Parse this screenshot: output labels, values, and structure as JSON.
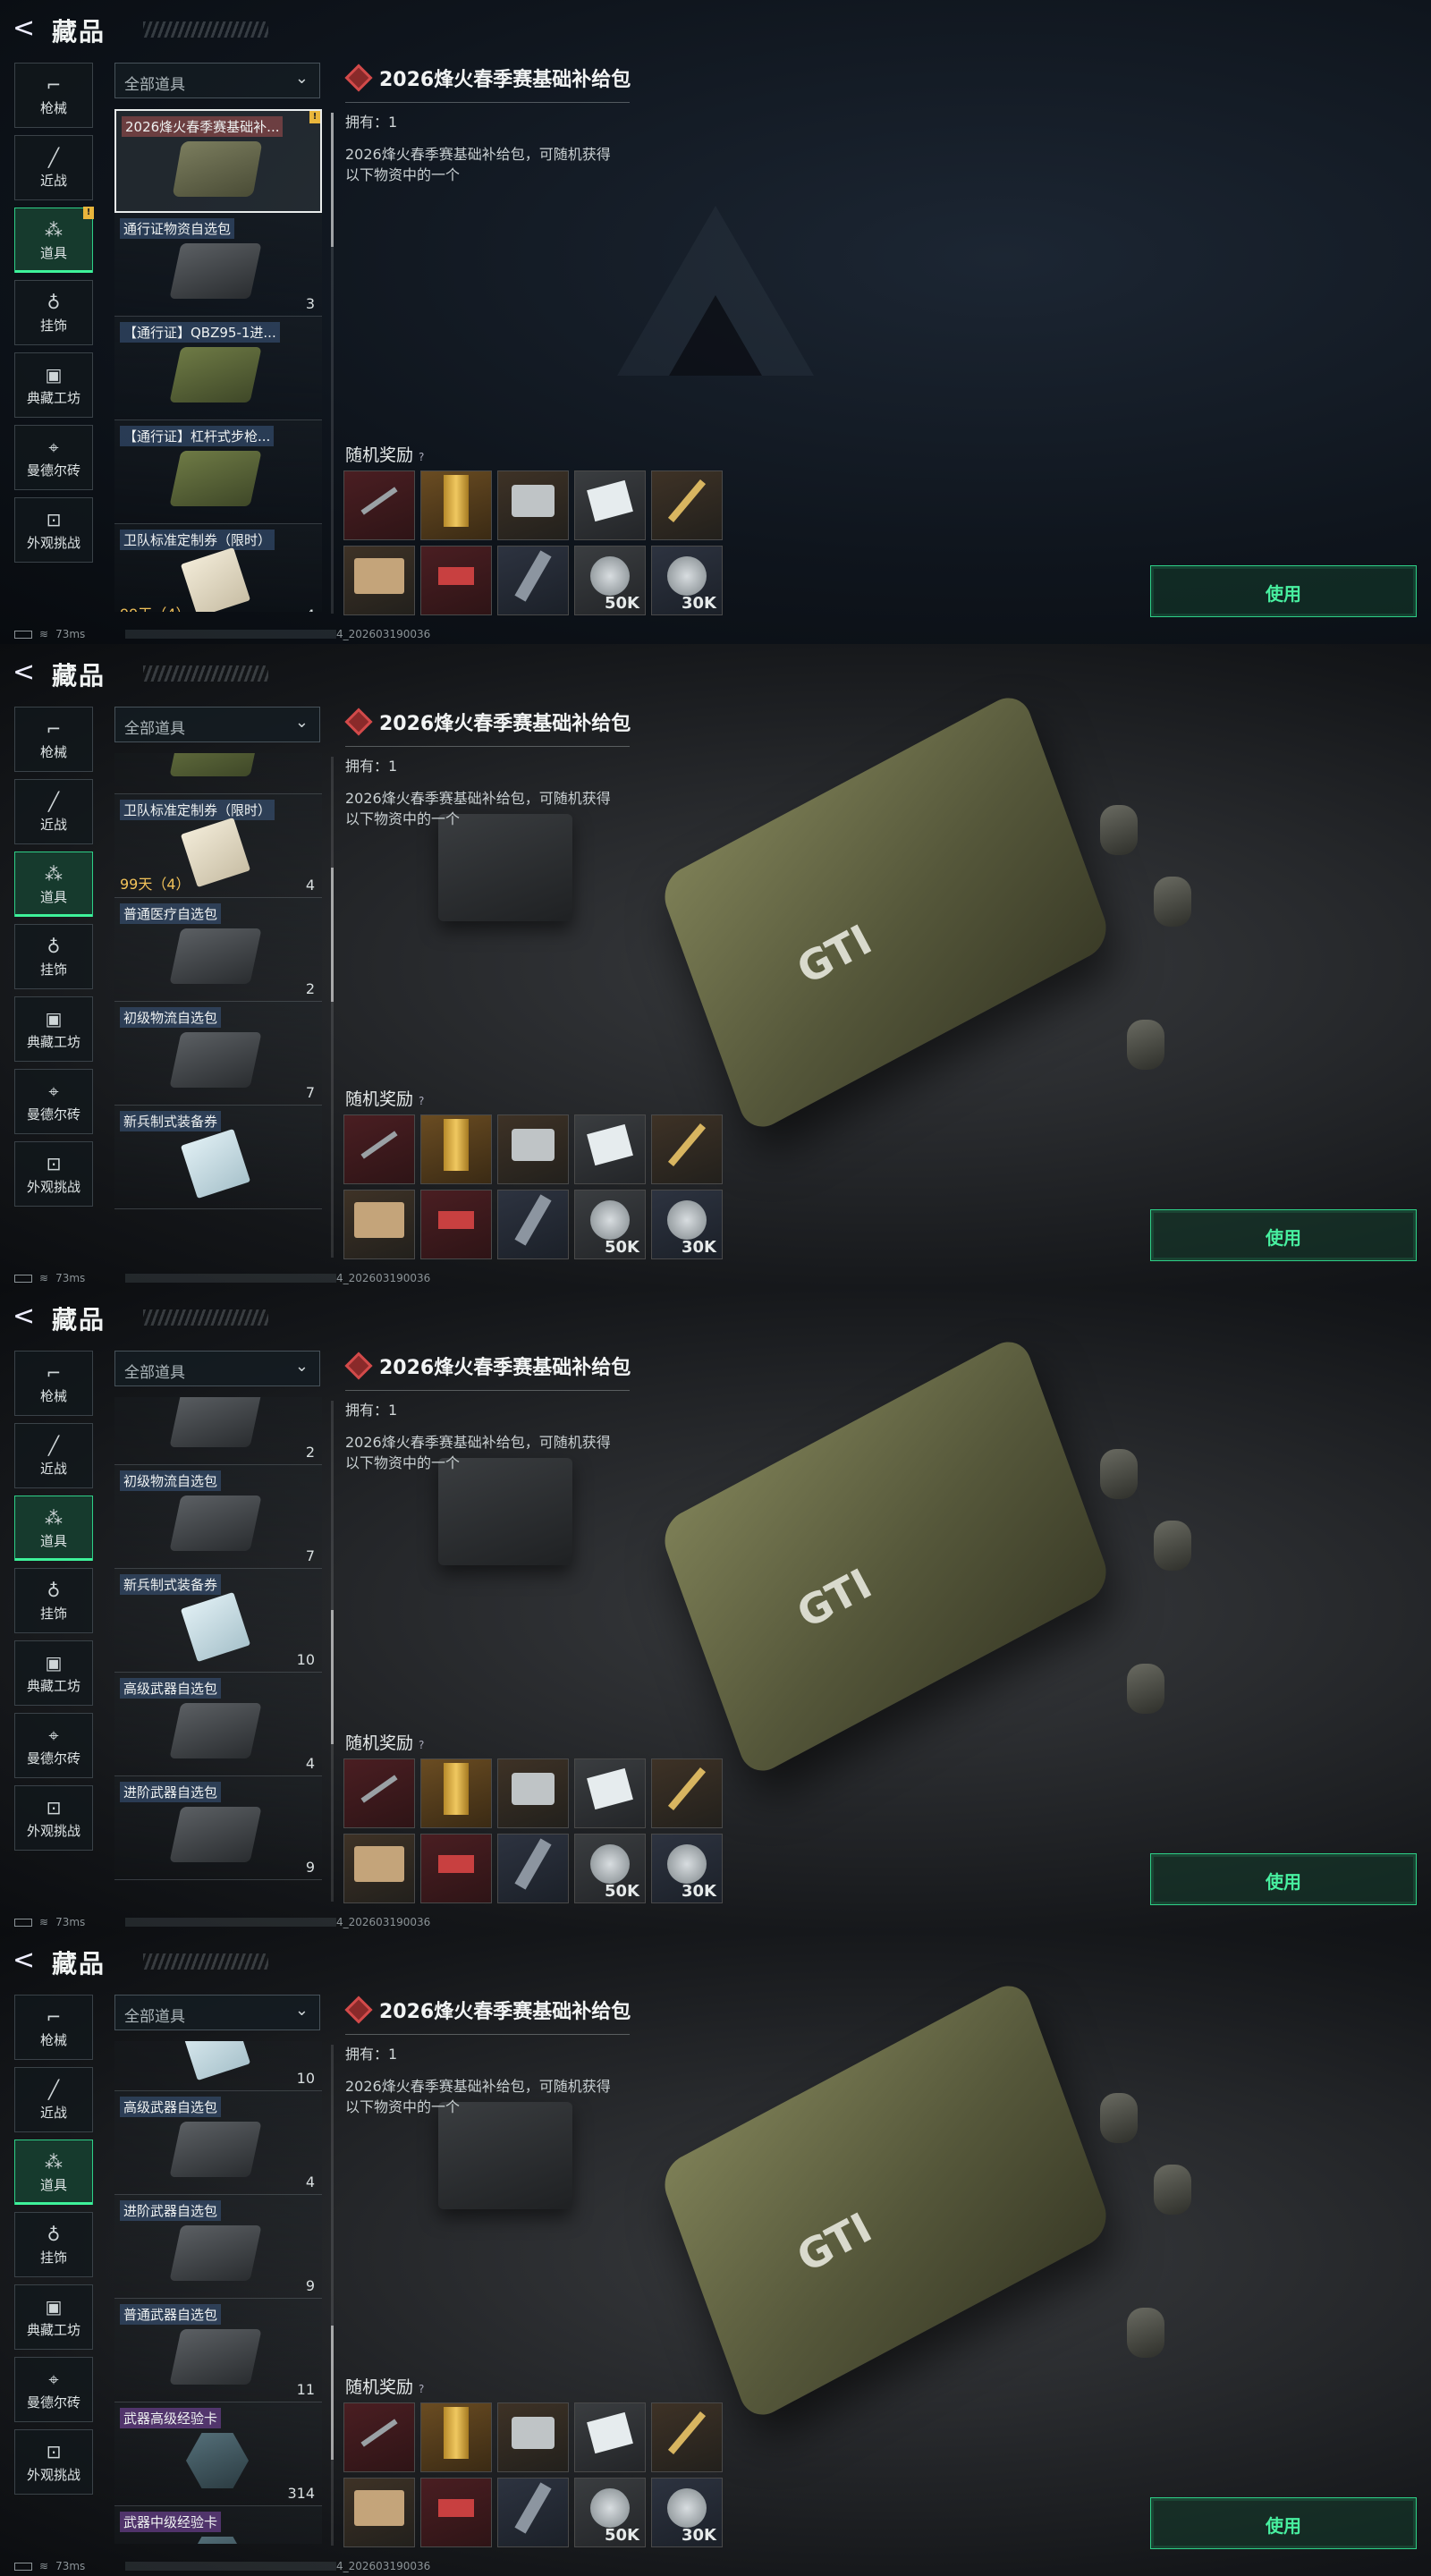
{
  "header": {
    "back": "<",
    "title": "藏品"
  },
  "categories": [
    {
      "label": "枪械",
      "icon": "gun-icon"
    },
    {
      "label": "近战",
      "icon": "knife-icon"
    },
    {
      "label": "道具",
      "icon": "items-icon"
    },
    {
      "label": "挂饰",
      "icon": "charm-icon"
    },
    {
      "label": "典藏工坊",
      "icon": "workshop-icon"
    },
    {
      "label": "曼德尔砖",
      "icon": "brick-icon"
    },
    {
      "label": "外观挑战",
      "icon": "challenge-icon"
    }
  ],
  "selected_category": "道具",
  "filter": {
    "label": "全部道具"
  },
  "detail": {
    "title": "2026烽火春季赛基础补给包",
    "owned": "拥有：1",
    "description": "2026烽火春季赛基础补给包，可随机获得以下物资中的一个",
    "reward_label": "随机奖励",
    "help": "?"
  },
  "rewards": [
    {
      "icon": "knife-icon",
      "label": ""
    },
    {
      "icon": "gold-bar-icon",
      "label": ""
    },
    {
      "icon": "camera-icon",
      "label": ""
    },
    {
      "icon": "document-icon",
      "label": ""
    },
    {
      "icon": "crossed-blade-icon",
      "label": ""
    },
    {
      "icon": "supply-box-icon",
      "label": ""
    },
    {
      "icon": "flag-card-icon",
      "label": ""
    },
    {
      "icon": "stick-icon",
      "label": ""
    },
    {
      "icon": "coin-icon",
      "label": "50K"
    },
    {
      "icon": "coin-icon",
      "label": "30K"
    }
  ],
  "use_button": "使用",
  "status": {
    "ping": "73ms",
    "uid": "4_202603190036"
  },
  "frames": [
    {
      "items": [
        {
          "name": "2026烽火春季赛基础补...",
          "count": "",
          "selected": true,
          "badge": "!"
        },
        {
          "name": "通行证物资自选包",
          "count": "3"
        },
        {
          "name": "【通行证】QBZ95-1进...",
          "count": ""
        },
        {
          "name": "【通行证】杠杆式步枪...",
          "count": ""
        },
        {
          "name": "卫队标准定制券（限时）",
          "count": "4",
          "timer": "99天（4）"
        }
      ]
    },
    {
      "items": [
        {
          "name": "【通行证】杠杆式步枪...",
          "count": ""
        },
        {
          "name": "卫队标准定制券（限时）",
          "count": "4",
          "timer": "99天（4）"
        },
        {
          "name": "普通医疗自选包",
          "count": "2"
        },
        {
          "name": "初级物流自选包",
          "count": "7"
        },
        {
          "name": "新兵制式装备券",
          "count": ""
        }
      ]
    },
    {
      "items": [
        {
          "name": "",
          "count": "2"
        },
        {
          "name": "初级物流自选包",
          "count": "7"
        },
        {
          "name": "新兵制式装备券",
          "count": "10"
        },
        {
          "name": "高级武器自选包",
          "count": "4"
        },
        {
          "name": "进阶武器自选包",
          "count": "9"
        }
      ]
    },
    {
      "items": [
        {
          "name": "",
          "count": "10"
        },
        {
          "name": "高级武器自选包",
          "count": "4"
        },
        {
          "name": "进阶武器自选包",
          "count": "9"
        },
        {
          "name": "普通武器自选包",
          "count": "11"
        },
        {
          "name": "武器高级经验卡",
          "count": "314"
        },
        {
          "name": "武器中级经验卡",
          "count": ""
        }
      ]
    }
  ]
}
